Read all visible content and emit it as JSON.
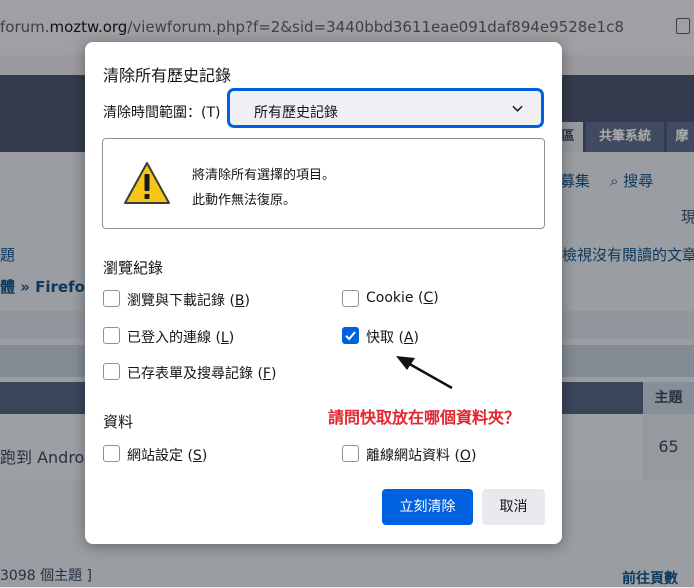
{
  "browser": {
    "url_prefix": "forum.",
    "url_host": "moztw.org",
    "url_rest": "/viewforum.php?f=2&sid=3440bbd3611eae091daf894e9528e1c8"
  },
  "background": {
    "tabs": [
      "區",
      "共筆系統",
      "摩"
    ],
    "links": [
      "募集",
      "搜尋"
    ],
    "now_text": "現",
    "left_edge_1": "題",
    "unread_link": "檢視沒有閱讀的文章",
    "breadcrumb": "體 » Firefo",
    "table_header": "主題",
    "row_text": "跑到 Androi",
    "row_count": "65",
    "topics_count": "3098 個主題 ]",
    "next_page": "前往頁數"
  },
  "dialog": {
    "title": "清除所有歷史記錄",
    "range_label": "清除時間範圍：(T)",
    "range_value": "所有歷史記錄",
    "warning_line1": "將清除所有選擇的項目。",
    "warning_line2": "此動作無法復原。",
    "history_heading": "瀏覽紀錄",
    "data_heading": "資料",
    "items": {
      "browsing": {
        "label": "瀏覽與下載記錄 (",
        "key": "B",
        "checked": false
      },
      "cookie": {
        "label": "Cookie (",
        "key": "C",
        "checked": false
      },
      "logins": {
        "label": "已登入的連線 (",
        "key": "L",
        "checked": false
      },
      "cache": {
        "label": "快取 (",
        "key": "A",
        "checked": true
      },
      "forms": {
        "label": "已存表單及搜尋記錄 (",
        "key": "F",
        "checked": false
      },
      "site_settings": {
        "label": "網站設定 (",
        "key": "S",
        "checked": false
      },
      "offline": {
        "label": "離線網站資料 (",
        "key": "O",
        "checked": false
      }
    },
    "close_paren": ")",
    "annotation": "請問快取放在哪個資料夾？",
    "clear_button": "立刻清除",
    "cancel_button": "取消"
  },
  "colors": {
    "accent": "#0061e0",
    "annotation": "#e2262f"
  }
}
